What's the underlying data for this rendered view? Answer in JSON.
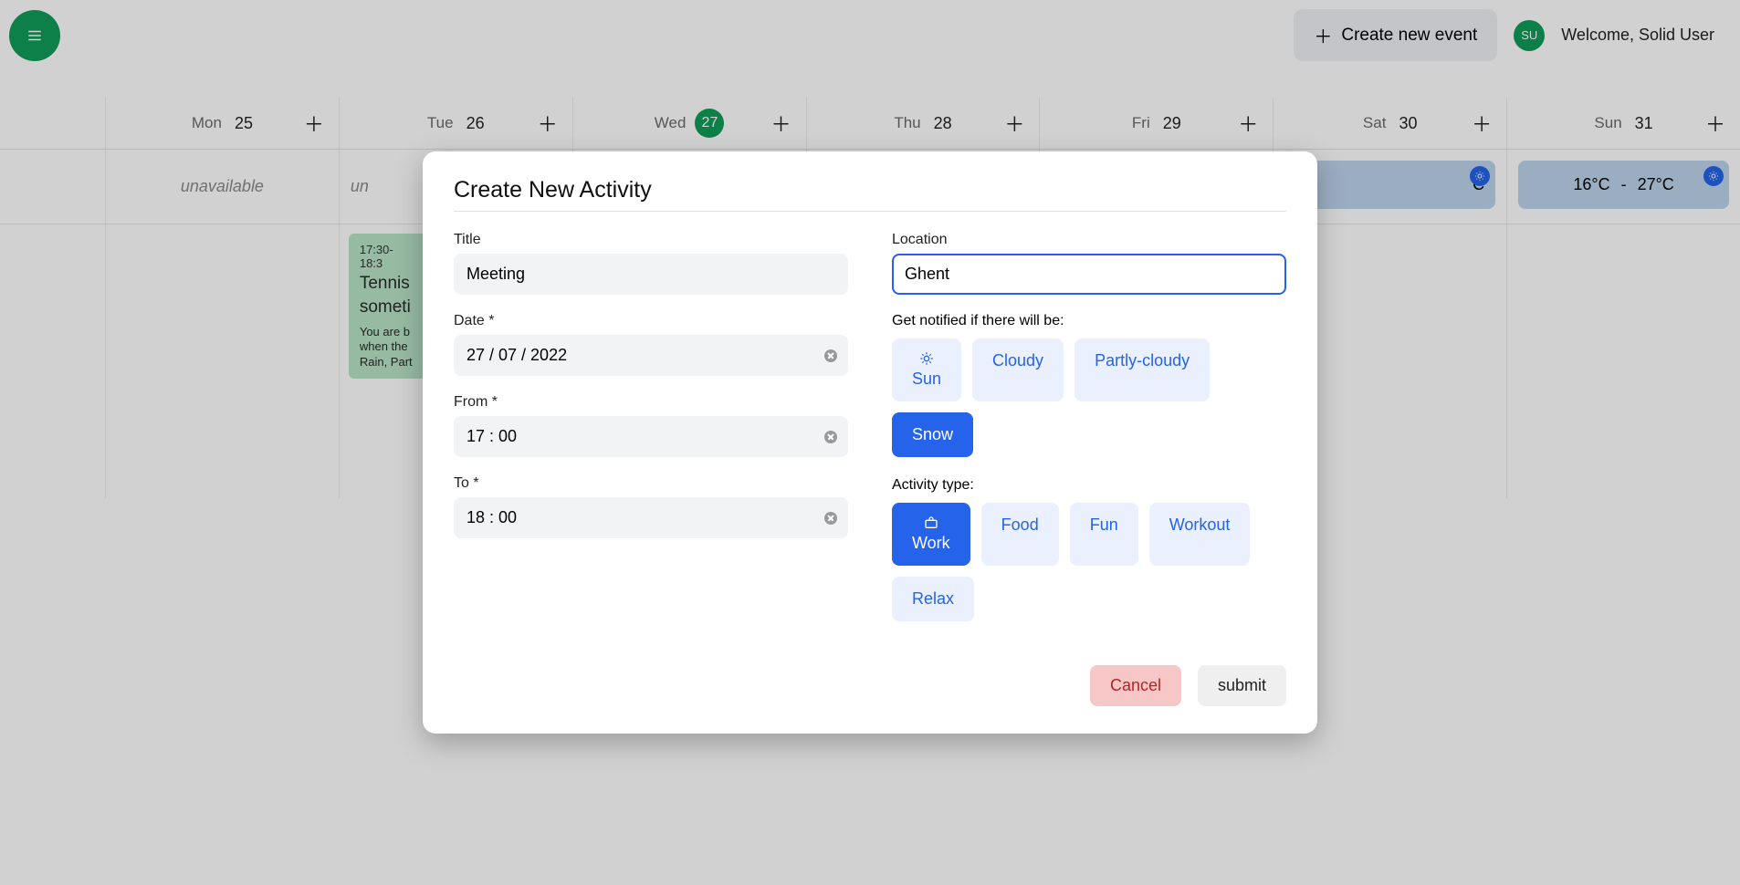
{
  "header": {
    "create_label": "Create new event",
    "avatar_initials": "SU",
    "welcome_text": "Welcome, Solid User"
  },
  "days": [
    {
      "dow": "Mon",
      "num": "25",
      "today": false
    },
    {
      "dow": "Tue",
      "num": "26",
      "today": false
    },
    {
      "dow": "Wed",
      "num": "27",
      "today": true
    },
    {
      "dow": "Thu",
      "num": "28",
      "today": false
    },
    {
      "dow": "Fri",
      "num": "29",
      "today": false
    },
    {
      "dow": "Sat",
      "num": "30",
      "today": false
    },
    {
      "dow": "Sun",
      "num": "31",
      "today": false
    }
  ],
  "weather": {
    "unavailable_label": "unavailable",
    "sat": {
      "high_partial": "C"
    },
    "sun": {
      "low": "16°C",
      "sep": "-",
      "high": "27°C"
    }
  },
  "event": {
    "time": "17:30-18:3",
    "title": "Tennis",
    "subtitle": "someti",
    "tip_line1": "You are b",
    "tip_line2": "when the",
    "tip_line3": "Rain, Part"
  },
  "modal": {
    "heading": "Create New Activity",
    "title_label": "Title",
    "title_value": "Meeting",
    "date_label": "Date *",
    "date_value": "27 / 07 / 2022",
    "from_label": "From *",
    "from_value": "17 : 00",
    "to_label": "To *",
    "to_value": "18 : 00",
    "location_label": "Location",
    "location_value": "Ghent",
    "notify_label": "Get notified if there will be:",
    "notify_options": [
      "Sun",
      "Cloudy",
      "Partly-cloudy",
      "Snow"
    ],
    "notify_selected": "Snow",
    "type_label": "Activity type:",
    "type_options": [
      "Work",
      "Food",
      "Fun",
      "Workout",
      "Relax"
    ],
    "type_selected": "Work",
    "cancel_label": "Cancel",
    "submit_label": "submit"
  }
}
